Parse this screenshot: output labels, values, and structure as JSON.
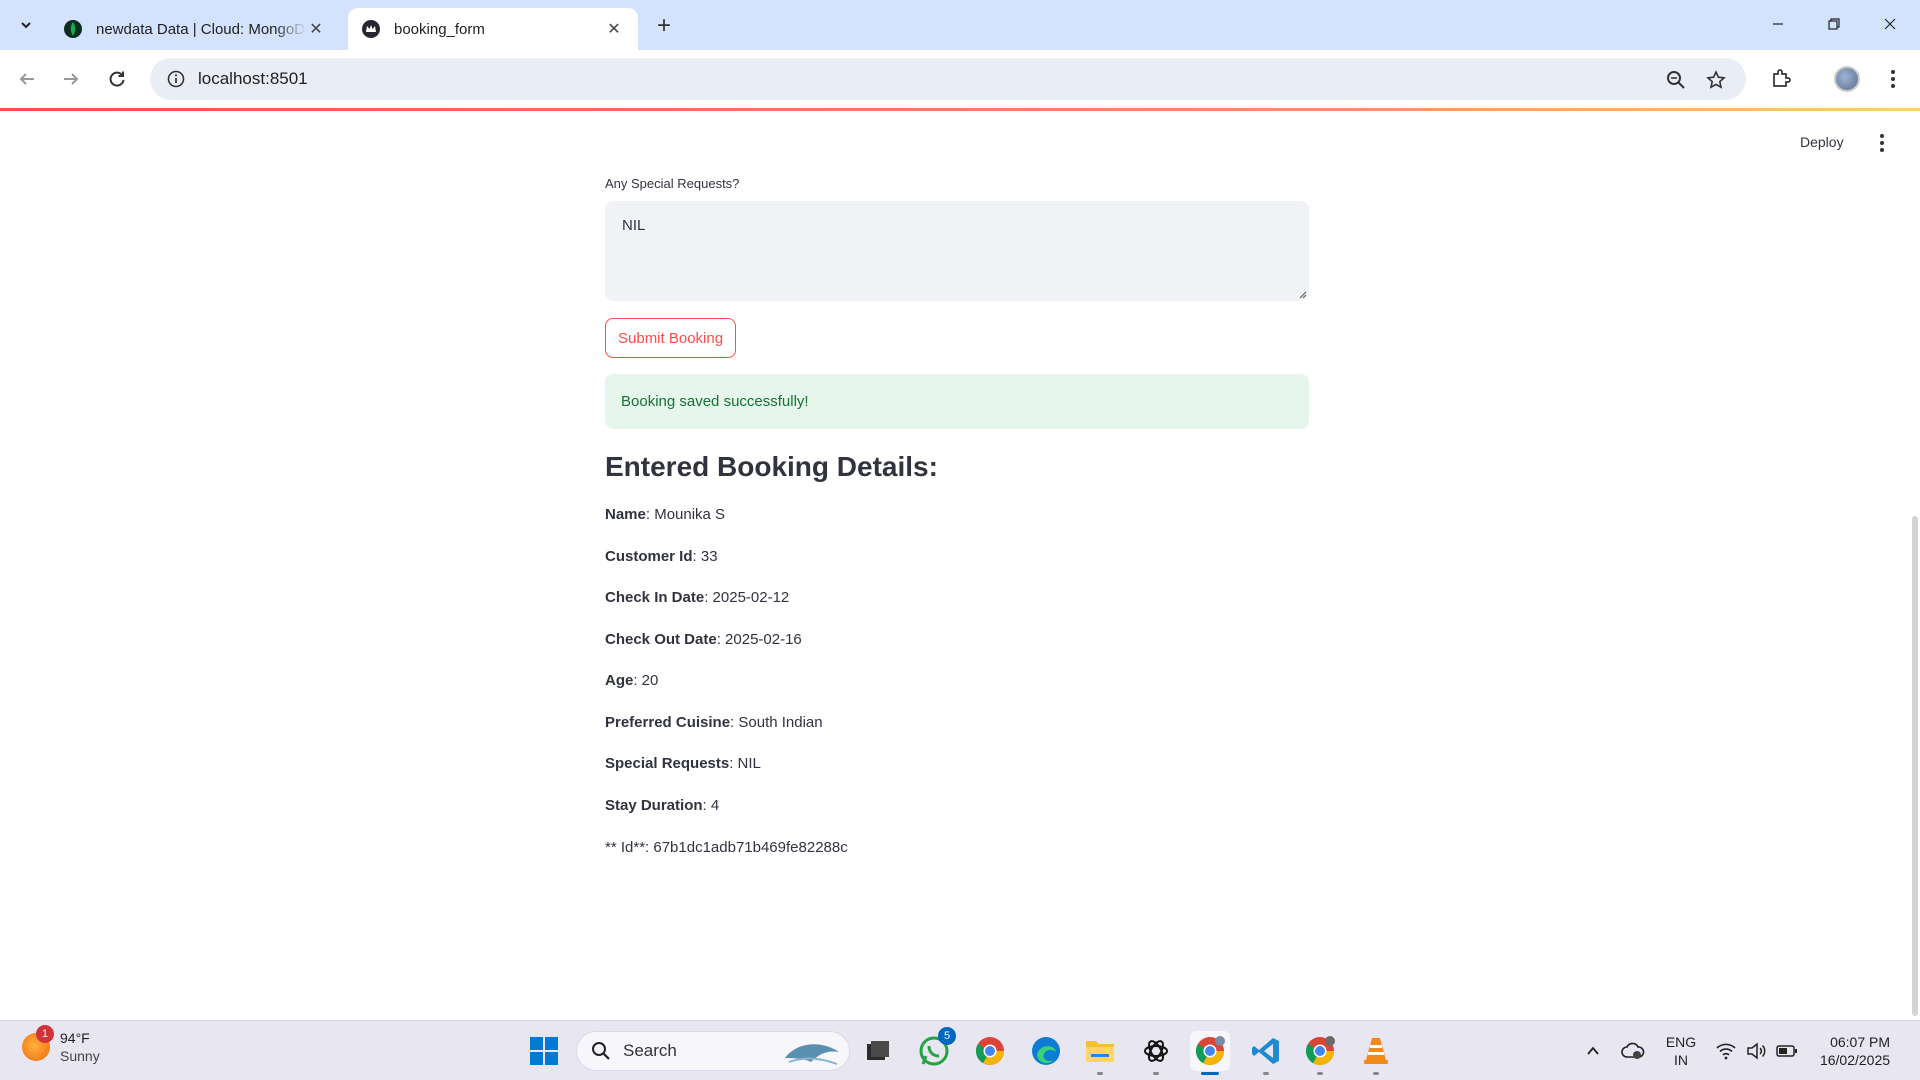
{
  "browser": {
    "tabs": [
      {
        "title": "newdata Data | Cloud: MongoDB Cloud",
        "active": false
      },
      {
        "title": "booking_form",
        "active": true
      }
    ],
    "url": "localhost:8501"
  },
  "app": {
    "deploy_label": "Deploy",
    "special_requests": {
      "label": "Any Special Requests?",
      "value": "NIL"
    },
    "submit_label": "Submit Booking",
    "success_message": "Booking saved successfully!",
    "details_heading": "Entered Booking Details:",
    "details": [
      {
        "key": "Name",
        "value": ": Mounika S"
      },
      {
        "key": "Customer Id",
        "value": ": 33"
      },
      {
        "key": "Check In Date",
        "value": ": 2025-02-12"
      },
      {
        "key": "Check Out Date",
        "value": ": 2025-02-16"
      },
      {
        "key": "Age",
        "value": ": 20"
      },
      {
        "key": "Preferred Cuisine",
        "value": ": South Indian"
      },
      {
        "key": "Special Requests",
        "value": ": NIL"
      },
      {
        "key": "Stay Duration",
        "value": ": 4"
      }
    ],
    "id_line": "** Id**: 67b1dc1adb71b469fe82288c"
  },
  "taskbar": {
    "weather": {
      "temp": "94°F",
      "condition": "Sunny",
      "badge": "1"
    },
    "search_label": "Search",
    "whatsapp_badge": "5",
    "language": {
      "line1": "ENG",
      "line2": "IN"
    },
    "clock": {
      "time": "06:07 PM",
      "date": "16/02/2025"
    }
  },
  "colors": {
    "accent": "#ff4b4b",
    "success_bg": "#e6f6ec",
    "success_text": "#177233",
    "tabstrip": "#d3e3fd"
  }
}
